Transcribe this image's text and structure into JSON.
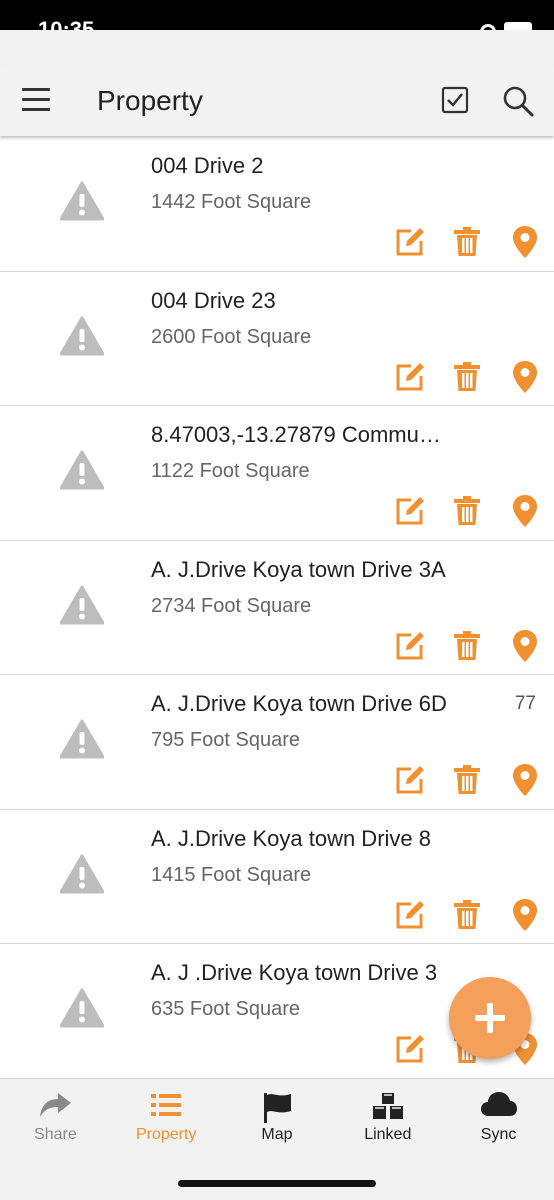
{
  "status_bar": {
    "time": "10:35"
  },
  "header": {
    "title": "Property",
    "select_icon": "checkbox-icon",
    "search_icon": "search-icon",
    "menu_icon": "hamburger-icon"
  },
  "colors": {
    "accent": "#F0902F",
    "warning_gray": "#BDBDBD",
    "fab": "#F5A05A",
    "inactive_tab": "#8A8A8A",
    "dark_tab": "#222222"
  },
  "properties": [
    {
      "name": "004 Drive 2",
      "area": "1442 Foot Square",
      "count": ""
    },
    {
      "name": "004 Drive 23",
      "area": "2600 Foot Square",
      "count": ""
    },
    {
      "name": "8.47003,-13.27879 Commu…",
      "area": "1122 Foot Square",
      "count": ""
    },
    {
      "name": "A. J.Drive Koya town Drive 3A",
      "area": "2734 Foot Square",
      "count": ""
    },
    {
      "name": "A. J.Drive Koya town Drive 6D",
      "area": "795 Foot Square",
      "count": "77"
    },
    {
      "name": "A. J.Drive Koya town Drive 8",
      "area": "1415 Foot Square",
      "count": ""
    },
    {
      "name": "A. J .Drive Koya town Drive 3",
      "area": "635 Foot Square",
      "count": ""
    }
  ],
  "row_icons": {
    "status": "warning-icon",
    "edit": "edit-icon",
    "delete": "trash-icon",
    "location": "map-pin-icon"
  },
  "fab": {
    "icon": "plus-icon"
  },
  "tabs": [
    {
      "label": "Share",
      "icon": "share-icon",
      "active": false
    },
    {
      "label": "Property",
      "icon": "list-icon",
      "active": true
    },
    {
      "label": "Map",
      "icon": "flag-icon",
      "active": false
    },
    {
      "label": "Linked",
      "icon": "cubes-icon",
      "active": false
    },
    {
      "label": "Sync",
      "icon": "cloud-icon",
      "active": false
    }
  ]
}
